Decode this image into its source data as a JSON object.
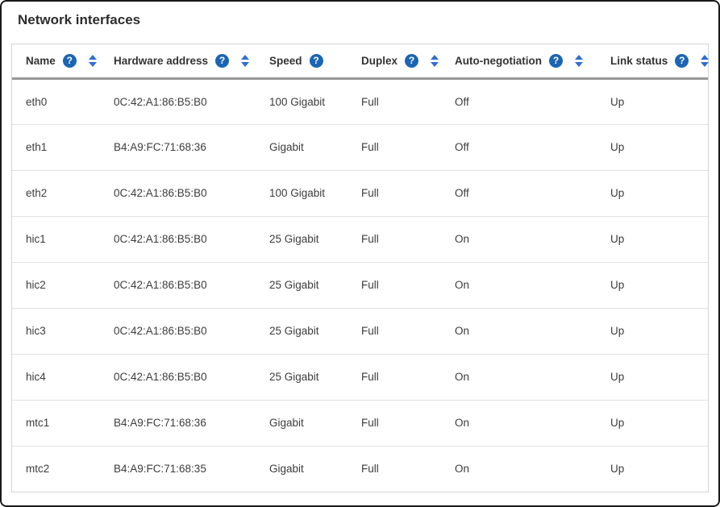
{
  "page": {
    "title": "Network interfaces"
  },
  "colors": {
    "help_icon_blue": "#1b65b4",
    "sort_arrow_blue": "#2e6ecf",
    "header_rule_gray": "#979797",
    "row_divider_gray": "#e2e2e2",
    "text_dark": "#3c3c3c"
  },
  "icons": {
    "help_glyph": "?"
  },
  "table": {
    "columns": [
      {
        "label": "Name",
        "help": true,
        "sortable": true
      },
      {
        "label": "Hardware address",
        "help": true,
        "sortable": true
      },
      {
        "label": "Speed",
        "help": true,
        "sortable": false
      },
      {
        "label": "Duplex",
        "help": true,
        "sortable": true
      },
      {
        "label": "Auto-negotiation",
        "help": true,
        "sortable": true
      },
      {
        "label": "Link status",
        "help": true,
        "sortable": true
      }
    ],
    "rows": [
      {
        "name": "eth0",
        "hardware_address": "0C:42:A1:86:B5:B0",
        "speed": "100 Gigabit",
        "duplex": "Full",
        "auto_negotiation": "Off",
        "link_status": "Up"
      },
      {
        "name": "eth1",
        "hardware_address": "B4:A9:FC:71:68:36",
        "speed": "Gigabit",
        "duplex": "Full",
        "auto_negotiation": "Off",
        "link_status": "Up"
      },
      {
        "name": "eth2",
        "hardware_address": "0C:42:A1:86:B5:B0",
        "speed": "100 Gigabit",
        "duplex": "Full",
        "auto_negotiation": "Off",
        "link_status": "Up"
      },
      {
        "name": "hic1",
        "hardware_address": "0C:42:A1:86:B5:B0",
        "speed": "25 Gigabit",
        "duplex": "Full",
        "auto_negotiation": "On",
        "link_status": "Up"
      },
      {
        "name": "hic2",
        "hardware_address": "0C:42:A1:86:B5:B0",
        "speed": "25 Gigabit",
        "duplex": "Full",
        "auto_negotiation": "On",
        "link_status": "Up"
      },
      {
        "name": "hic3",
        "hardware_address": "0C:42:A1:86:B5:B0",
        "speed": "25 Gigabit",
        "duplex": "Full",
        "auto_negotiation": "On",
        "link_status": "Up"
      },
      {
        "name": "hic4",
        "hardware_address": "0C:42:A1:86:B5:B0",
        "speed": "25 Gigabit",
        "duplex": "Full",
        "auto_negotiation": "On",
        "link_status": "Up"
      },
      {
        "name": "mtc1",
        "hardware_address": "B4:A9:FC:71:68:36",
        "speed": "Gigabit",
        "duplex": "Full",
        "auto_negotiation": "On",
        "link_status": "Up"
      },
      {
        "name": "mtc2",
        "hardware_address": "B4:A9:FC:71:68:35",
        "speed": "Gigabit",
        "duplex": "Full",
        "auto_negotiation": "On",
        "link_status": "Up"
      }
    ]
  }
}
